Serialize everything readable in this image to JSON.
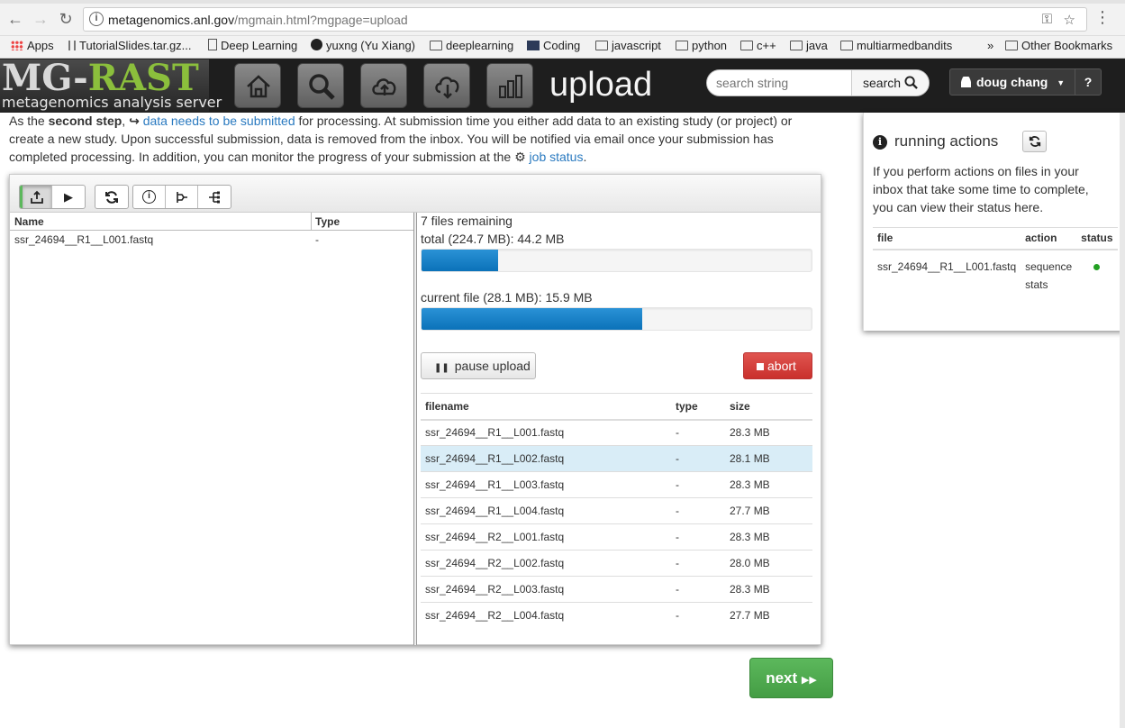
{
  "browser": {
    "url_host": "metagenomics.anl.gov",
    "url_path": "/mgmain.html?mgpage=upload",
    "bookmarks": [
      "Apps",
      "TutorialSlides.tar.gz...",
      "Deep Learning",
      "yuxng (Yu Xiang)",
      "deeplearning",
      "Coding",
      "javascript",
      "python",
      "c++",
      "java",
      "multiarmedbandits"
    ],
    "overflow": "»",
    "other_bookmarks": "Other Bookmarks"
  },
  "header": {
    "logo_main": "MG-",
    "logo_accent": "RAST",
    "logo_sub": "metagenomics analysis server",
    "page_title": "upload",
    "search_placeholder": "search string",
    "search_label": "search",
    "user_name": "doug chang",
    "help_label": "?"
  },
  "intro": {
    "part1": "As the ",
    "bold": "second step",
    "part2": ", ",
    "link1": "data needs to be submitted",
    "part3": " for processing. At submission time you either add data to an existing study (or project) or create a new study. Upon successful submission, data is removed from the inbox. You will be notified via email once your submission has completed processing. In addition, you can monitor the progress of your submission at the ",
    "link2": "job status",
    "part4": "."
  },
  "left_table": {
    "col_name": "Name",
    "col_type": "Type",
    "rows": [
      {
        "name": "ssr_24694__R1__L001.fastq",
        "type": "-"
      }
    ]
  },
  "upload": {
    "remaining": "7 files remaining",
    "total_label": "total (224.7 MB): 44.2 MB",
    "total_progress": 0.197,
    "current_label": "current file (28.1 MB): 15.9 MB",
    "current_progress": 0.566,
    "pause_label": "pause upload",
    "abort_label": "abort"
  },
  "file_table": {
    "col_filename": "filename",
    "col_type": "type",
    "col_size": "size",
    "rows": [
      {
        "filename": "ssr_24694__R1__L001.fastq",
        "type": "-",
        "size": "28.3 MB"
      },
      {
        "filename": "ssr_24694__R1__L002.fastq",
        "type": "-",
        "size": "28.1 MB"
      },
      {
        "filename": "ssr_24694__R1__L003.fastq",
        "type": "-",
        "size": "28.3 MB"
      },
      {
        "filename": "ssr_24694__R1__L004.fastq",
        "type": "-",
        "size": "27.7 MB"
      },
      {
        "filename": "ssr_24694__R2__L001.fastq",
        "type": "-",
        "size": "28.3 MB"
      },
      {
        "filename": "ssr_24694__R2__L002.fastq",
        "type": "-",
        "size": "28.0 MB"
      },
      {
        "filename": "ssr_24694__R2__L003.fastq",
        "type": "-",
        "size": "28.3 MB"
      },
      {
        "filename": "ssr_24694__R2__L004.fastq",
        "type": "-",
        "size": "27.7 MB"
      }
    ]
  },
  "next_label": "next",
  "side": {
    "title": "running actions",
    "text": "If you perform actions on files in your inbox that take some time to complete, you can view their status here.",
    "col_file": "file",
    "col_action": "action",
    "col_status": "status",
    "rows": [
      {
        "file": "ssr_24694__R1__L001.fastq",
        "action": "sequence stats",
        "status_color": "#22a022"
      }
    ]
  },
  "colors": {
    "accent": "#2a7ac0",
    "progress": "#0b72b9",
    "danger": "#c9302c",
    "success": "#5cb85c",
    "highlight_row": "#d9edf7"
  }
}
